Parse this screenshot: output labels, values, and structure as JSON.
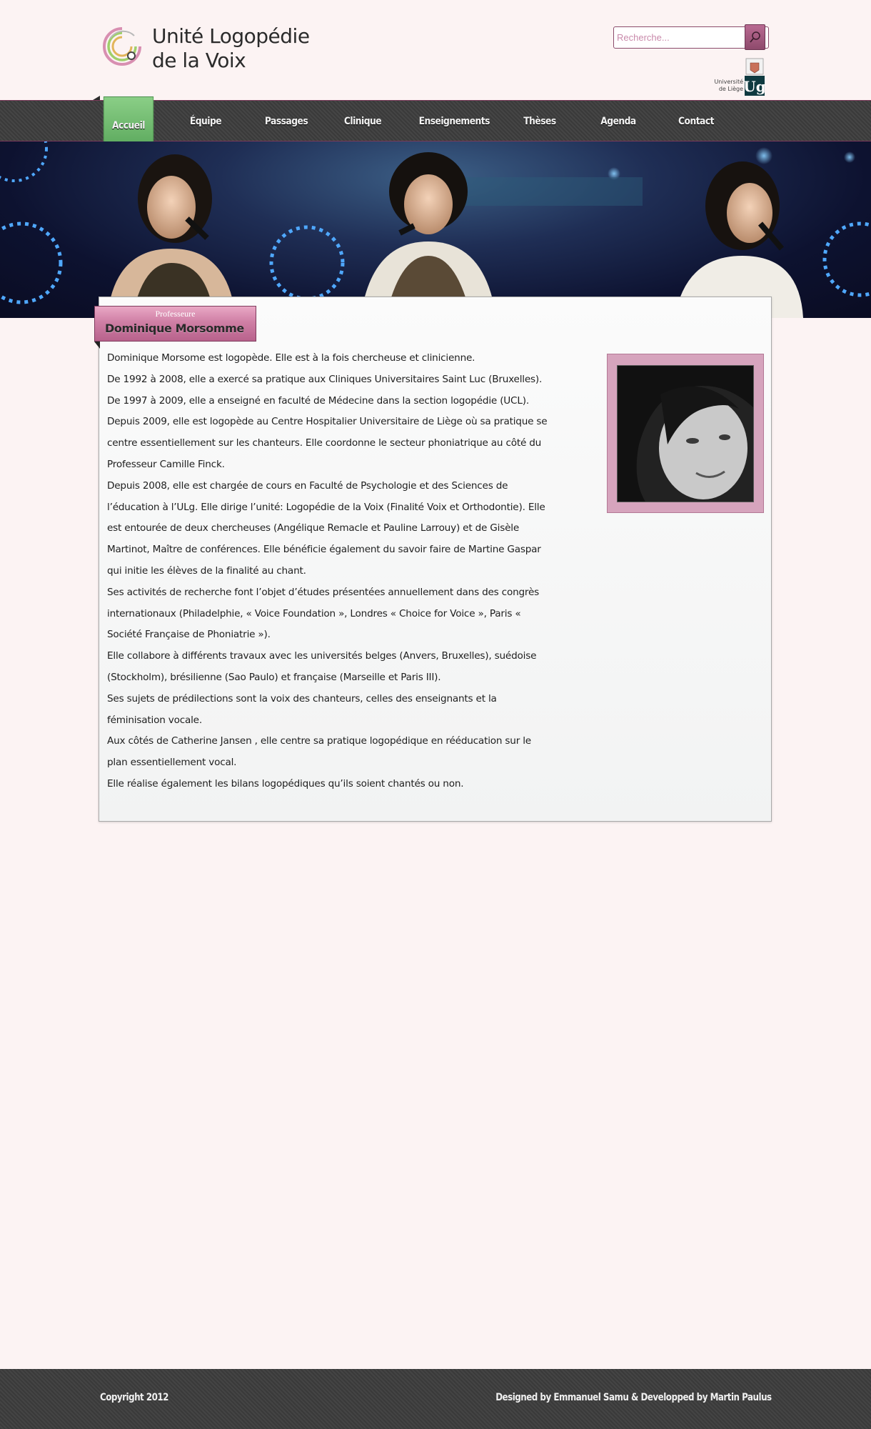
{
  "header": {
    "site_title_line1": "Unité Logopédie",
    "site_title_line2": "de la Voix",
    "search_placeholder": "Recherche...",
    "university_line1": "Université",
    "university_line2": "de Liège",
    "university_mark": "Ug"
  },
  "nav": {
    "items": [
      {
        "label": "Accueil",
        "active": true
      },
      {
        "label": "Équipe"
      },
      {
        "label": "Passages"
      },
      {
        "label": "Clinique"
      },
      {
        "label": "Enseignements"
      },
      {
        "label": "Thèses"
      },
      {
        "label": "Agenda"
      },
      {
        "label": "Contact"
      }
    ]
  },
  "profile": {
    "role": "Professeure",
    "name": "Dominique Morsomme",
    "bio_lines": [
      "Dominique Morsome est logopède. Elle est à la fois chercheuse et clinicienne.",
      "De 1992 à 2008, elle a exercé sa pratique aux Cliniques Universitaires Saint Luc (Bruxelles).",
      "De 1997 à 2009, elle a enseigné en faculté de Médecine dans la section logopédie (UCL).",
      "Depuis 2009, elle est logopède au Centre Hospitalier Universitaire de Liège où sa pratique se",
      "centre essentiellement sur les chanteurs. Elle coordonne le secteur phoniatrique au côté du",
      "Professeur Camille Finck.",
      "Depuis 2008, elle est chargée de cours en Faculté de Psychologie et des Sciences de",
      "l’éducation à l’ULg. Elle dirige l’unité: Logopédie de la Voix (Finalité Voix et Orthodontie). Elle",
      "est entourée de deux chercheuses (Angélique Remacle et Pauline Larrouy) et de Gisèle",
      "Martinot, Maître de conférences. Elle bénéficie également du savoir faire de Martine Gaspar",
      "qui initie les élèves de la finalité au chant.",
      "Ses activités de recherche font l’objet d’études présentées annuellement dans des congrès",
      "internationaux (Philadelphie, « Voice Foundation », Londres « Choice for Voice », Paris «",
      "Société Française de Phoniatrie »).",
      "Elle collabore à différents travaux avec les universités belges (Anvers, Bruxelles), suédoise",
      "(Stockholm), brésilienne (Sao Paulo) et française (Marseille et Paris III).",
      "Ses sujets de prédilections sont la voix des chanteurs, celles des enseignants et la",
      "féminisation vocale.",
      "Aux côtés de Catherine Jansen , elle centre sa pratique logopédique en rééducation sur le",
      "plan essentiellement vocal.",
      "Elle réalise également les bilans logopédiques qu’ils soient chantés ou non."
    ]
  },
  "footer": {
    "copyright": "Copyright 2012",
    "credits": "Designed by Emmanuel Samu & Developped by Martin Paulus"
  },
  "colors": {
    "background": "#fcf3f3",
    "accent_pink": "#c77a9f",
    "nav_active_green": "#6dbb6c",
    "nav_dark": "#3f3f3f"
  },
  "icons": {
    "search": "magnifier-icon",
    "logo": "concentric-arcs-logo"
  }
}
